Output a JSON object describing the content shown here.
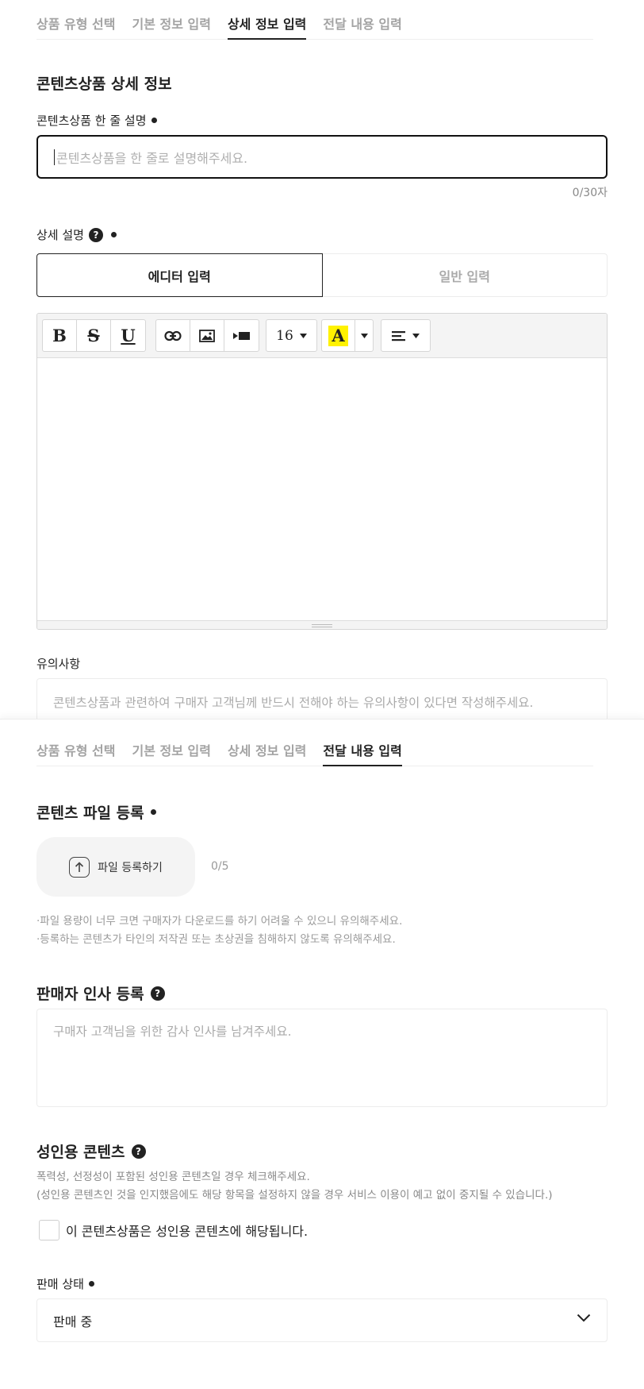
{
  "tabs": [
    "상품 유형 선택",
    "기본 정보 입력",
    "상세 정보 입력",
    "전달 내용 입력"
  ],
  "detail": {
    "section_title": "콘텐츠상품 상세 정보",
    "oneline_label": "콘텐츠상품 한 줄 설명",
    "oneline_placeholder": "콘텐츠상품을 한 줄로 설명해주세요.",
    "oneline_counter": "0/30자",
    "desc_label": "상세 설명",
    "editor_tab": "에디터 입력",
    "plain_tab": "일반 입력",
    "font_size": "16",
    "notice_label": "유의사항",
    "notice_placeholder": "콘텐츠상품과 관련하여 구매자 고객님께 반드시 전해야 하는 유의사항이 있다면 작성해주세요."
  },
  "delivery": {
    "file_title": "콘텐츠 파일 등록",
    "upload_label": "파일 등록하기",
    "file_count": "0/5",
    "note1": "·파일 용량이 너무 크면 구매자가 다운로드를 하기 어려울 수 있으니 유의해주세요.",
    "note2": "·등록하는 콘텐츠가 타인의 저작권 또는 초상권을 침해하지 않도록 유의해주세요.",
    "greeting_title": "판매자 인사 등록",
    "greeting_placeholder": "구매자 고객님을 위한 감사 인사를 남겨주세요.",
    "adult_title": "성인용 콘텐츠",
    "adult_note1": "폭력성, 선정성이 포함된 성인용 콘텐츠일 경우 체크해주세요.",
    "adult_note2": "(성인용 콘텐츠인 것을 인지했음에도 해당 항목을 설정하지 않을 경우 서비스 이용이 예고 없이 중지될 수 있습니다.)",
    "adult_checkbox_label": "이 콘텐츠상품은 성인용 콘텐츠에 해당됩니다.",
    "status_label": "판매 상태",
    "status_value": "판매 중"
  },
  "colors": {
    "highlight": "#fff200",
    "text": "#222222",
    "muted": "#a3a3a3"
  }
}
